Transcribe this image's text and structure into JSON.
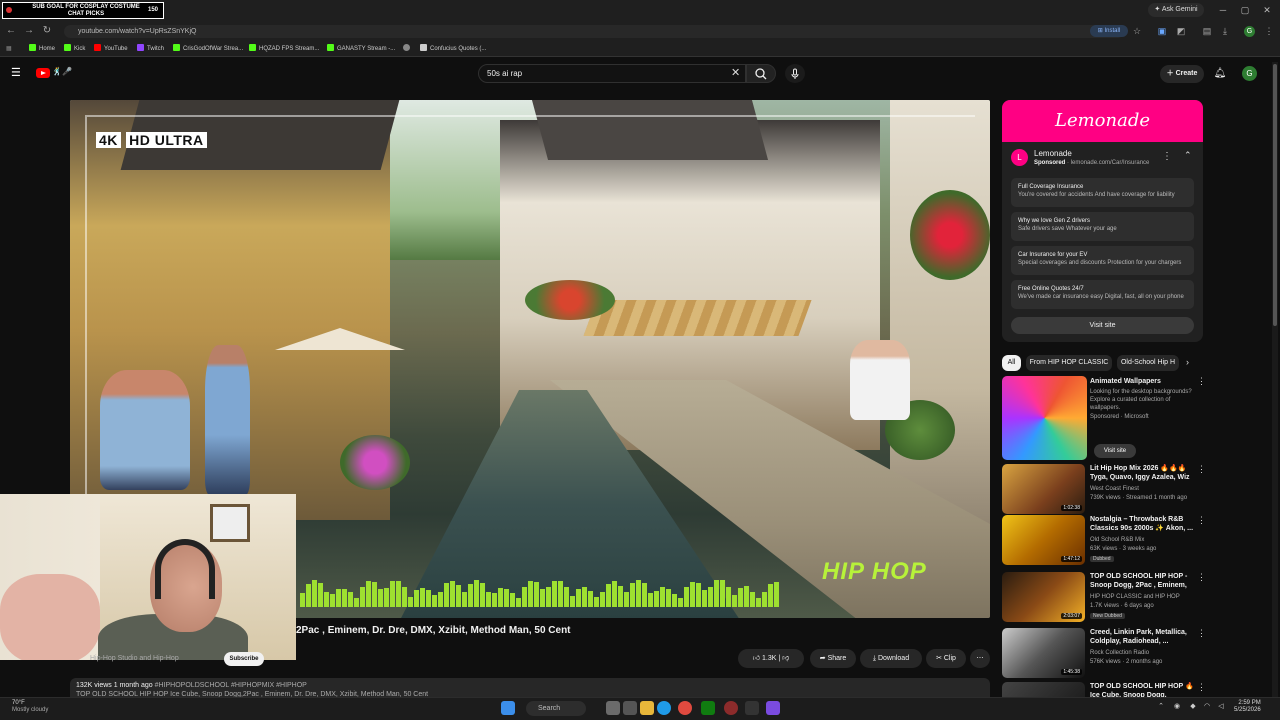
{
  "overlay": {
    "goal_text": "SUB GOAL FOR COSPLAY COSTUME",
    "goal_subtext": "CHAT PICKS",
    "goal_count": "150"
  },
  "browser": {
    "ask_gemini": "Ask Gemini",
    "url": "youtube.com/watch?v=UpRsZSnYKjQ",
    "install_label": "Install",
    "bookmarks": [
      "Home",
      "Kick",
      "YouTube",
      "Twitch",
      "CrisGodOfWar Strea...",
      "HQZAD FPS Stream...",
      "GANASTY Stream -...",
      "Confucius Quotes (..."
    ]
  },
  "youtube": {
    "search_value": "50s ai rap",
    "create_label": "Create",
    "avatar_letter": "G"
  },
  "video": {
    "overlay_hd": "HD ULTRA",
    "overlay_4k": "4K",
    "overlay_hiphop": "HIP HOP",
    "title_visible": "2Pac , Eminem, Dr. Dre, DMX, Xzibit, Method Man, 50 Cent",
    "channel": "Hip-Hop Studio and Hip-Hop",
    "subscribe_label": "Subscribe",
    "likes": "1.3K",
    "share_label": "Share",
    "download_label": "Download",
    "clip_label": "Clip",
    "views_date": "132K views  1 month ago",
    "tags": "#HIPHOPOLDSCHOOL #HIPHOPMIX #HIPHOP",
    "desc_line2": "TOP OLD SCHOOL HIP HOP Ice Cube, Snoop Dogg,2Pac , Eminem, Dr. Dre, DMX, Xzibit, Method Man, 50 Cent"
  },
  "ad": {
    "banner": "Lemonade",
    "logo_letter": "L",
    "name": "Lemonade",
    "sponsored": "Sponsored",
    "domain": "lemonade.com/Car/Insurance",
    "rows": [
      {
        "title": "Full Coverage Insurance",
        "sub": "You're covered for accidents And have coverage for liability"
      },
      {
        "title": "Why we love Gen Z drivers",
        "sub": "Safe drivers save Whatever your age"
      },
      {
        "title": "Car Insurance for your EV",
        "sub": "Special coverages and discounts Protection for your chargers"
      },
      {
        "title": "Free Online Quotes 24/7",
        "sub": "We've made car insurance easy Digital, fast, all on your phone"
      }
    ],
    "visit_label": "Visit site"
  },
  "chips": [
    "All",
    "From HIP HOP CLASSIC",
    "Old-School Hip H"
  ],
  "promo": {
    "title": "Animated Wallpapers",
    "desc": "Looking for the desktop backgrounds? Explore a curated collection of wallpapers.",
    "sponsored": "Sponsored · Microsoft",
    "visit_label": "Visit site"
  },
  "recommendations": [
    {
      "title": "Lit Hip Hop Mix 2026 🔥🔥🔥 Tyga, Quavo, Iggy Azalea, Wiz ...",
      "channel": "West Coast Finest",
      "meta": "739K views · Streamed 1 month ago",
      "duration": "1:02:38",
      "badge": ""
    },
    {
      "title": "Nostalgia – Throwback R&B Classics 90s 2000s ✨ Akon, ...",
      "channel": "Old School R&B Mix",
      "meta": "63K views · 3 weeks ago",
      "duration": "1:47:12",
      "badge": "Dubbed"
    },
    {
      "title": "TOP OLD SCHOOL HIP HOP - Snoop Dogg, 2Pac , Eminem, D...",
      "channel": "HIP HOP CLASSIC and HIP HOP",
      "meta": "1.7K views · 6 days ago",
      "duration": "2:03:07",
      "badge": "New  Dubbed"
    },
    {
      "title": "Creed, Linkin Park, Metallica, Coldplay, Radiohead, ...",
      "channel": "Rock Collection Radio",
      "meta": "576K views · 2 months ago",
      "duration": "1:45:38",
      "badge": ""
    },
    {
      "title": "TOP OLD SCHOOL HIP HOP 🔥 Ice Cube, Snoop Dogg, Emine...",
      "channel": "",
      "meta": "",
      "duration": "",
      "badge": ""
    }
  ],
  "taskbar": {
    "weather_temp": "70°F",
    "weather_desc": "Mostly cloudy",
    "search_label": "Search",
    "time": "2:59 PM",
    "date": "5/25/2026"
  }
}
